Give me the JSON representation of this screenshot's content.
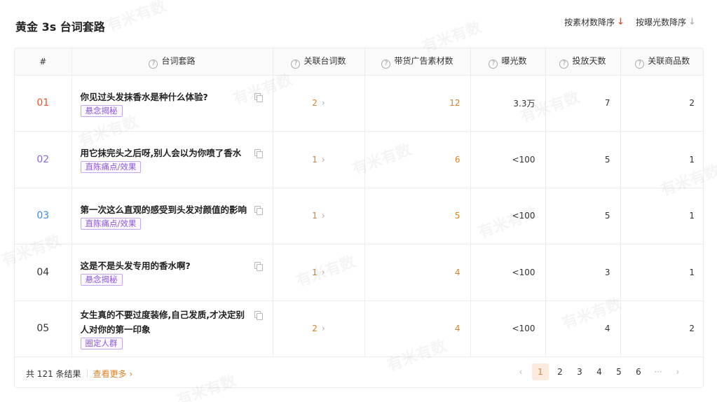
{
  "title": "黄金 3s 台词套路",
  "sort": {
    "by_material": "按素材数降序",
    "by_exposure": "按曝光数降序"
  },
  "columns": {
    "index": "#",
    "phrase": "台词套路",
    "related_phrases": "关联台词数",
    "ad_materials": "带货广告素材数",
    "exposure": "曝光数",
    "days": "投放天数",
    "products": "关联商品数"
  },
  "rows": [
    {
      "rank": "01",
      "rank_color": "#e0562e",
      "phrase": "你见过头发抹香水是种什么体验?",
      "tag": "悬念揭秘",
      "related": "2",
      "materials": "12",
      "exposure": "3.3万",
      "days": "7",
      "products": "2"
    },
    {
      "rank": "02",
      "rank_color": "#8b6ad6",
      "phrase": "用它抹完头之后呀,别人会以为你喷了香水",
      "tag": "直陈痛点/效果",
      "related": "1",
      "materials": "6",
      "exposure": "<100",
      "days": "5",
      "products": "1"
    },
    {
      "rank": "03",
      "rank_color": "#3b8fd6",
      "phrase": "第一次这么直观的感受到头发对颜值的影响",
      "tag": "直陈痛点/效果",
      "related": "1",
      "materials": "5",
      "exposure": "<100",
      "days": "5",
      "products": "1"
    },
    {
      "rank": "04",
      "rank_color": "#333333",
      "phrase": "这是不是头发专用的香水啊?",
      "tag": "悬念揭秘",
      "related": "1",
      "materials": "4",
      "exposure": "<100",
      "days": "3",
      "products": "1"
    },
    {
      "rank": "05",
      "rank_color": "#333333",
      "phrase": "女生真的不要过度装修,自己发质,才决定别人对你的第一印象",
      "tag": "圈定人群",
      "related": "2",
      "materials": "4",
      "exposure": "<100",
      "days": "4",
      "products": "2"
    }
  ],
  "footer": {
    "total": "共 121 条结果",
    "more": "查看更多",
    "pages": [
      "1",
      "2",
      "3",
      "4",
      "5",
      "6"
    ],
    "ellipsis": "···",
    "current_page": 1
  },
  "watermark": "有米有数",
  "icons": {
    "help": "question-circle-icon",
    "copy": "copy-icon",
    "chevron": "chevron-right-icon",
    "sort_active": "arrow-down-red-icon",
    "sort_idle": "arrow-down-gray-icon"
  },
  "colors": {
    "accent": "#d8822d",
    "tag": "#8a5ad6",
    "sort_active": "#e0562e"
  }
}
